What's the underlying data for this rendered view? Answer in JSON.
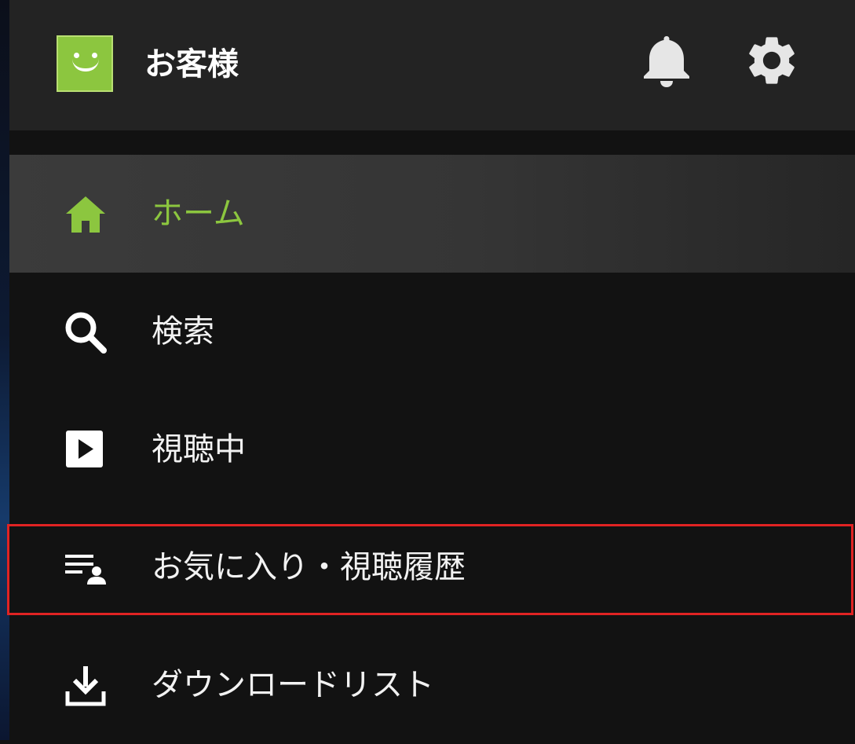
{
  "header": {
    "user_name": "お客様",
    "avatar_icon": "smiley-avatar-icon",
    "avatar_color": "#8cc63f",
    "notification_icon": "bell-icon",
    "settings_icon": "gear-icon"
  },
  "menu": {
    "accent_color": "#8cc63f",
    "items": [
      {
        "label": "ホーム",
        "icon": "home-icon",
        "active": true
      },
      {
        "label": "検索",
        "icon": "search-icon",
        "active": false
      },
      {
        "label": "視聴中",
        "icon": "play-icon",
        "active": false
      },
      {
        "label": "お気に入り・視聴履歴",
        "icon": "favorites-history-icon",
        "active": false,
        "highlighted": true
      },
      {
        "label": "ダウンロードリスト",
        "icon": "download-icon",
        "active": false
      }
    ]
  },
  "annotation": {
    "highlight_color": "#e02323"
  }
}
